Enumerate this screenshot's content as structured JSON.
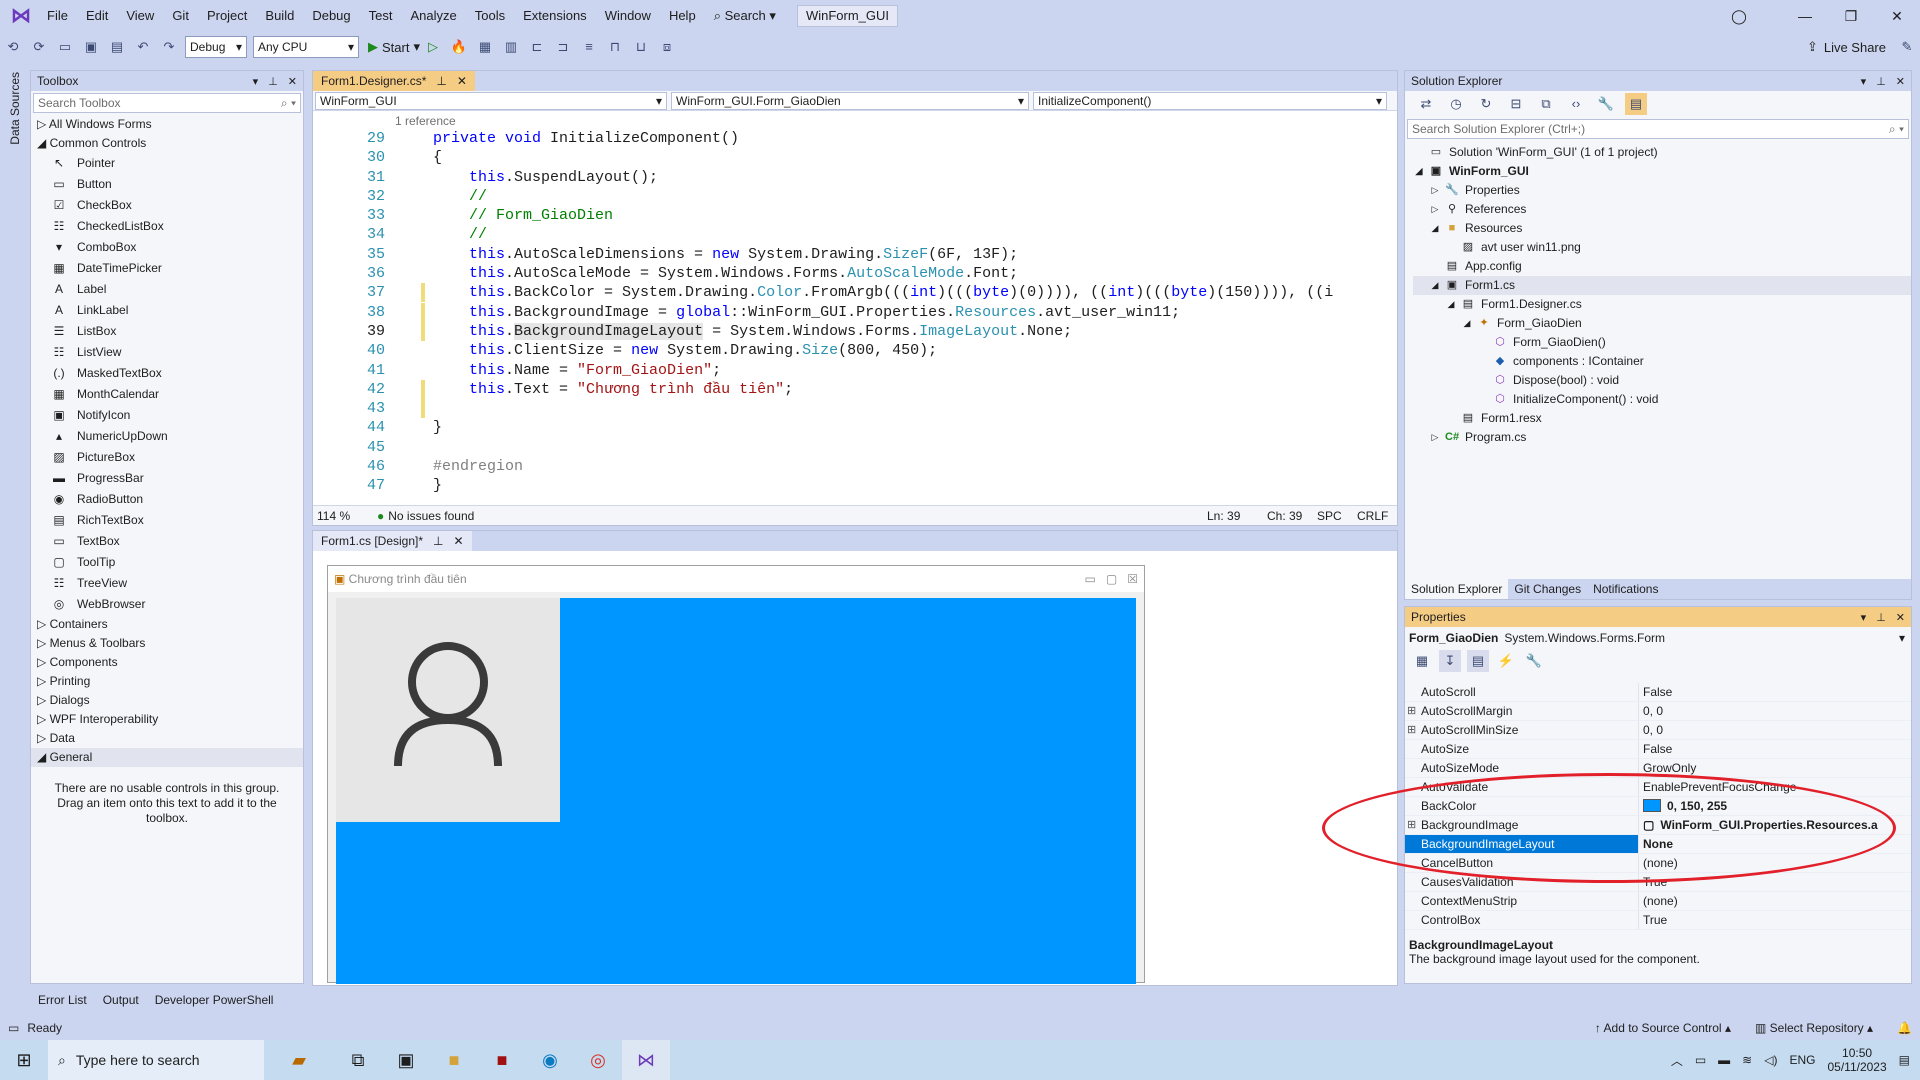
{
  "menu": [
    "File",
    "Edit",
    "View",
    "Git",
    "Project",
    "Build",
    "Debug",
    "Test",
    "Analyze",
    "Tools",
    "Extensions",
    "Window",
    "Help"
  ],
  "search_label": "Search",
  "solution_name": "WinForm_GUI",
  "toolbar": {
    "config": "Debug",
    "platform": "Any CPU",
    "start": "Start",
    "live_share": "Live Share"
  },
  "leftstrip": "Data Sources",
  "toolbox": {
    "title": "Toolbox",
    "search_placeholder": "Search Toolbox",
    "all_windows_forms": "All Windows Forms",
    "common_controls": "Common Controls",
    "items": [
      "Pointer",
      "Button",
      "CheckBox",
      "CheckedListBox",
      "ComboBox",
      "DateTimePicker",
      "Label",
      "LinkLabel",
      "ListBox",
      "ListView",
      "MaskedTextBox",
      "MonthCalendar",
      "NotifyIcon",
      "NumericUpDown",
      "PictureBox",
      "ProgressBar",
      "RadioButton",
      "RichTextBox",
      "TextBox",
      "ToolTip",
      "TreeView",
      "WebBrowser"
    ],
    "categories": [
      "Containers",
      "Menus & Toolbars",
      "Components",
      "Printing",
      "Dialogs",
      "WPF Interoperability",
      "Data",
      "General"
    ],
    "general_note": "There are no usable controls in this group. Drag an item onto this text to add it to the toolbox."
  },
  "editor": {
    "tab": "Form1.Designer.cs*",
    "nav1": "WinForm_GUI",
    "nav2": "WinForm_GUI.Form_GiaoDien",
    "nav3": "InitializeComponent()",
    "reference": "1 reference",
    "lines": [
      {
        "n": "29",
        "html": "<span class='kw'>private void</span> InitializeComponent()"
      },
      {
        "n": "30",
        "html": "{"
      },
      {
        "n": "31",
        "html": "    <span class='kw'>this</span>.SuspendLayout();"
      },
      {
        "n": "32",
        "html": "    <span class='cm'>//</span>"
      },
      {
        "n": "33",
        "html": "    <span class='cm'>// Form_GiaoDien</span>"
      },
      {
        "n": "34",
        "html": "    <span class='cm'>//</span>"
      },
      {
        "n": "35",
        "html": "    <span class='kw'>this</span>.AutoScaleDimensions = <span class='kw'>new</span> System.Drawing.<span class='ty'>SizeF</span>(6F, 13F);"
      },
      {
        "n": "36",
        "html": "    <span class='kw'>this</span>.AutoScaleMode = System.Windows.Forms.<span class='ty'>AutoScaleMode</span>.Font;"
      },
      {
        "n": "37",
        "html": "    <span class='kw'>this</span>.BackColor = System.Drawing.<span class='ty'>Color</span>.FromArgb(((<span class='kw'>int</span>)(((<span class='kw'>byte</span>)(0)))), ((<span class='kw'>int</span>)(((<span class='kw'>byte</span>)(150)))), ((i"
      },
      {
        "n": "38",
        "html": "    <span class='kw'>this</span>.BackgroundImage = <span class='kw'>global</span>::WinForm_GUI.Properties.<span class='ty'>Resources</span>.avt_user_win11;"
      },
      {
        "n": "39",
        "html": "    <span class='kw'>this</span>.<span style='background:#e5e5e5'>BackgroundImageLayout</span> = System.Windows.Forms.<span class='ty'>ImageLayout</span>.None;"
      },
      {
        "n": "40",
        "html": "    <span class='kw'>this</span>.ClientSize = <span class='kw'>new</span> System.Drawing.<span class='ty'>Size</span>(800, 450);"
      },
      {
        "n": "41",
        "html": "    <span class='kw'>this</span>.Name = <span class='st'>\"Form_GiaoDien\"</span>;"
      },
      {
        "n": "42",
        "html": "    <span class='kw'>this</span>.Text = <span class='st'>\"Chương trình đầu tiên\"</span>;"
      },
      {
        "n": "43",
        "html": ""
      },
      {
        "n": "44",
        "html": "}"
      },
      {
        "n": "45",
        "html": ""
      },
      {
        "n": "46",
        "html": "<span style='color:#808080'>#endregion</span>"
      },
      {
        "n": "47",
        "html": "}"
      }
    ],
    "zoom": "114 %",
    "issues": "No issues found",
    "ln": "Ln: 39",
    "ch": "Ch: 39",
    "spc": "SPC",
    "crlf": "CRLF"
  },
  "designer": {
    "tab": "Form1.cs [Design]*",
    "form_title": "Chương trình đầu tiên"
  },
  "solution_explorer": {
    "title": "Solution Explorer",
    "search_placeholder": "Search Solution Explorer (Ctrl+;)",
    "solution": "Solution 'WinForm_GUI' (1 of 1 project)",
    "project": "WinForm_GUI",
    "properties": "Properties",
    "references": "References",
    "resources": "Resources",
    "resource_file": "avt user win11.png",
    "app_config": "App.config",
    "form1": "Form1.cs",
    "designer_cs": "Form1.Designer.cs",
    "form_class": "Form_GiaoDien",
    "m1": "Form_GiaoDien()",
    "m2": "components : IContainer",
    "m3": "Dispose(bool) : void",
    "m4": "InitializeComponent() : void",
    "resx": "Form1.resx",
    "program": "Program.cs",
    "tabs": [
      "Solution Explorer",
      "Git Changes",
      "Notifications"
    ]
  },
  "properties": {
    "title": "Properties",
    "object": "Form_GiaoDien",
    "object_type": "System.Windows.Forms.Form",
    "rows": [
      {
        "name": "AutoScroll",
        "value": "False"
      },
      {
        "name": "AutoScrollMargin",
        "value": "0, 0"
      },
      {
        "name": "AutoScrollMinSize",
        "value": "0, 0"
      },
      {
        "name": "AutoSize",
        "value": "False"
      },
      {
        "name": "AutoSizeMode",
        "value": "GrowOnly"
      },
      {
        "name": "AutoValidate",
        "value": "EnablePreventFocusChange"
      },
      {
        "name": "BackColor",
        "value": "0, 150, 255"
      },
      {
        "name": "BackgroundImage",
        "value": "WinForm_GUI.Properties.Resources.a"
      },
      {
        "name": "BackgroundImageLayout",
        "value": "None"
      },
      {
        "name": "CancelButton",
        "value": "(none)"
      },
      {
        "name": "CausesValidation",
        "value": "True"
      },
      {
        "name": "ContextMenuStrip",
        "value": "(none)"
      },
      {
        "name": "ControlBox",
        "value": "True"
      }
    ],
    "desc_title": "BackgroundImageLayout",
    "desc": "The background image layout used for the component."
  },
  "bottom_tabs": [
    "Error List",
    "Output",
    "Developer PowerShell"
  ],
  "status": {
    "ready": "Ready",
    "source_control": "Add to Source Control",
    "repo": "Select Repository"
  },
  "taskbar": {
    "search": "Type here to search",
    "lang": "ENG",
    "time": "10:50",
    "date": "05/11/2023"
  },
  "colors": {
    "accent": "#0078d7",
    "form_back": "#0096ff",
    "highlight": "#e2202a"
  }
}
